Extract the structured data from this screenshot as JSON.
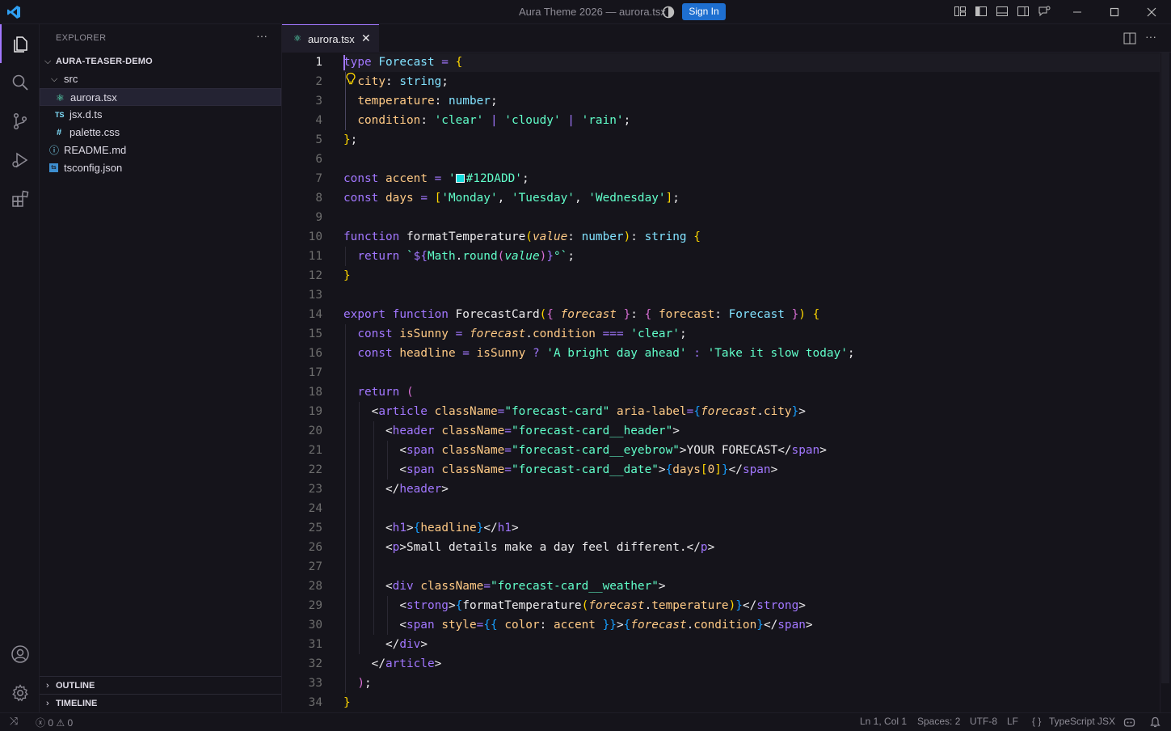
{
  "titlebar": {
    "title": "Aura Theme 2026 — aurora.tsx",
    "signin_label": "Sign In",
    "icons": [
      "vscode-logo-icon",
      "copilot-icon",
      "customize-layout-icon",
      "toggle-primary-sidebar-icon",
      "toggle-panel-icon",
      "toggle-secondary-sidebar-icon",
      "chat-icon",
      "minimize-icon",
      "maximize-icon",
      "close-icon"
    ]
  },
  "activitybar": {
    "items": [
      "explorer-icon",
      "search-icon",
      "source-control-icon",
      "run-debug-icon",
      "extensions-icon"
    ],
    "bottom": [
      "accounts-icon",
      "settings-gear-icon"
    ]
  },
  "sidebar": {
    "title": "EXPLORER",
    "more": "···",
    "root": "AURA-TEASER-DEMO",
    "tree": [
      {
        "label": "src",
        "type": "folder",
        "icon": ""
      },
      {
        "label": "aurora.tsx",
        "type": "file",
        "icon": "⚛",
        "selected": true
      },
      {
        "label": "jsx.d.ts",
        "type": "file",
        "icon": "TS"
      },
      {
        "label": "palette.css",
        "type": "file",
        "icon": "#"
      },
      {
        "label": "README.md",
        "type": "file",
        "icon": "ⓘ"
      },
      {
        "label": "tsconfig.json",
        "type": "file",
        "icon": "ts"
      }
    ],
    "panels": [
      "OUTLINE",
      "TIMELINE"
    ]
  },
  "tabs": [
    {
      "label": "aurora.tsx",
      "icon": "⚛",
      "close": "✕",
      "active": true
    }
  ],
  "editor": {
    "active_line": 1,
    "line_numbers": [
      "1",
      "2",
      "3",
      "4",
      "5",
      "6",
      "7",
      "8",
      "9",
      "10",
      "11",
      "12",
      "13",
      "14",
      "15",
      "16",
      "17",
      "18",
      "19",
      "20",
      "21",
      "22",
      "23",
      "24",
      "25",
      "26",
      "27",
      "28",
      "29",
      "30",
      "31",
      "32",
      "33",
      "34"
    ],
    "lines": [
      [
        {
          "t": "type",
          "c": "kw"
        },
        {
          "t": " ",
          "c": "pu"
        },
        {
          "t": "Forecast",
          "c": "ty"
        },
        {
          "t": " = ",
          "c": "op"
        },
        {
          "t": "{",
          "c": "b1"
        }
      ],
      [
        {
          "t": "  ",
          "c": "pu"
        },
        {
          "t": "city",
          "c": "pr"
        },
        {
          "t": ": ",
          "c": "pu"
        },
        {
          "t": "string",
          "c": "ty"
        },
        {
          "t": ";",
          "c": "pu"
        }
      ],
      [
        {
          "t": "  ",
          "c": "pu"
        },
        {
          "t": "temperature",
          "c": "pr"
        },
        {
          "t": ": ",
          "c": "pu"
        },
        {
          "t": "number",
          "c": "ty"
        },
        {
          "t": ";",
          "c": "pu"
        }
      ],
      [
        {
          "t": "  ",
          "c": "pu"
        },
        {
          "t": "condition",
          "c": "pr"
        },
        {
          "t": ": ",
          "c": "pu"
        },
        {
          "t": "'clear'",
          "c": "st"
        },
        {
          "t": " | ",
          "c": "op"
        },
        {
          "t": "'cloudy'",
          "c": "st"
        },
        {
          "t": " | ",
          "c": "op"
        },
        {
          "t": "'rain'",
          "c": "st"
        },
        {
          "t": ";",
          "c": "pu"
        }
      ],
      [
        {
          "t": "}",
          "c": "b1"
        },
        {
          "t": ";",
          "c": "pu"
        }
      ],
      [],
      [
        {
          "t": "const",
          "c": "kw"
        },
        {
          "t": " ",
          "c": "pu"
        },
        {
          "t": "accent",
          "c": "vr"
        },
        {
          "t": " = ",
          "c": "op"
        },
        {
          "t": "'",
          "c": "st"
        },
        {
          "t": "",
          "c": "swatch"
        },
        {
          "t": "#12DADD'",
          "c": "st"
        },
        {
          "t": ";",
          "c": "pu"
        }
      ],
      [
        {
          "t": "const",
          "c": "kw"
        },
        {
          "t": " ",
          "c": "pu"
        },
        {
          "t": "days",
          "c": "vr"
        },
        {
          "t": " = ",
          "c": "op"
        },
        {
          "t": "[",
          "c": "b1"
        },
        {
          "t": "'Monday'",
          "c": "st"
        },
        {
          "t": ", ",
          "c": "pu"
        },
        {
          "t": "'Tuesday'",
          "c": "st"
        },
        {
          "t": ", ",
          "c": "pu"
        },
        {
          "t": "'Wednesday'",
          "c": "st"
        },
        {
          "t": "]",
          "c": "b1"
        },
        {
          "t": ";",
          "c": "pu"
        }
      ],
      [],
      [
        {
          "t": "function",
          "c": "kw"
        },
        {
          "t": " ",
          "c": "pu"
        },
        {
          "t": "formatTemperature",
          "c": "fn"
        },
        {
          "t": "(",
          "c": "b1"
        },
        {
          "t": "value",
          "c": "vr it"
        },
        {
          "t": ": ",
          "c": "pu"
        },
        {
          "t": "number",
          "c": "ty"
        },
        {
          "t": ")",
          "c": "b1"
        },
        {
          "t": ": ",
          "c": "pu"
        },
        {
          "t": "string",
          "c": "ty"
        },
        {
          "t": " ",
          "c": "pu"
        },
        {
          "t": "{",
          "c": "b1"
        }
      ],
      [
        {
          "t": "  ",
          "c": "pu"
        },
        {
          "t": "return",
          "c": "kw"
        },
        {
          "t": " ",
          "c": "pu"
        },
        {
          "t": "`",
          "c": "st"
        },
        {
          "t": "${",
          "c": "kw"
        },
        {
          "t": "Math",
          "c": "st"
        },
        {
          "t": ".",
          "c": "pu"
        },
        {
          "t": "round",
          "c": "st"
        },
        {
          "t": "(",
          "c": "b2"
        },
        {
          "t": "value",
          "c": "st it"
        },
        {
          "t": ")",
          "c": "b2"
        },
        {
          "t": "}",
          "c": "kw"
        },
        {
          "t": "°`",
          "c": "st"
        },
        {
          "t": ";",
          "c": "pu"
        }
      ],
      [
        {
          "t": "}",
          "c": "b1"
        }
      ],
      [],
      [
        {
          "t": "export",
          "c": "kw"
        },
        {
          "t": " ",
          "c": "pu"
        },
        {
          "t": "function",
          "c": "kw"
        },
        {
          "t": " ",
          "c": "pu"
        },
        {
          "t": "ForecastCard",
          "c": "fn"
        },
        {
          "t": "(",
          "c": "b1"
        },
        {
          "t": "{",
          "c": "b2"
        },
        {
          "t": " ",
          "c": "pu"
        },
        {
          "t": "forecast",
          "c": "vr it"
        },
        {
          "t": " ",
          "c": "pu"
        },
        {
          "t": "}",
          "c": "b2"
        },
        {
          "t": ": ",
          "c": "pu"
        },
        {
          "t": "{",
          "c": "b2"
        },
        {
          "t": " ",
          "c": "pu"
        },
        {
          "t": "forecast",
          "c": "pr"
        },
        {
          "t": ": ",
          "c": "pu"
        },
        {
          "t": "Forecast",
          "c": "ty"
        },
        {
          "t": " ",
          "c": "pu"
        },
        {
          "t": "}",
          "c": "b2"
        },
        {
          "t": ")",
          "c": "b1"
        },
        {
          "t": " ",
          "c": "pu"
        },
        {
          "t": "{",
          "c": "b1"
        }
      ],
      [
        {
          "t": "  ",
          "c": "pu"
        },
        {
          "t": "const",
          "c": "kw"
        },
        {
          "t": " ",
          "c": "pu"
        },
        {
          "t": "isSunny",
          "c": "vr"
        },
        {
          "t": " = ",
          "c": "op"
        },
        {
          "t": "forecast",
          "c": "vr it"
        },
        {
          "t": ".",
          "c": "pu"
        },
        {
          "t": "condition",
          "c": "pr"
        },
        {
          "t": " === ",
          "c": "op"
        },
        {
          "t": "'clear'",
          "c": "st"
        },
        {
          "t": ";",
          "c": "pu"
        }
      ],
      [
        {
          "t": "  ",
          "c": "pu"
        },
        {
          "t": "const",
          "c": "kw"
        },
        {
          "t": " ",
          "c": "pu"
        },
        {
          "t": "headline",
          "c": "vr"
        },
        {
          "t": " = ",
          "c": "op"
        },
        {
          "t": "isSunny",
          "c": "vr"
        },
        {
          "t": " ? ",
          "c": "op"
        },
        {
          "t": "'A bright day ahead'",
          "c": "st"
        },
        {
          "t": " : ",
          "c": "op"
        },
        {
          "t": "'Take it slow today'",
          "c": "st"
        },
        {
          "t": ";",
          "c": "pu"
        }
      ],
      [],
      [
        {
          "t": "  ",
          "c": "pu"
        },
        {
          "t": "return",
          "c": "kw"
        },
        {
          "t": " ",
          "c": "pu"
        },
        {
          "t": "(",
          "c": "b2"
        }
      ],
      [
        {
          "t": "    ",
          "c": "pu"
        },
        {
          "t": "<",
          "c": "pu"
        },
        {
          "t": "article",
          "c": "tg"
        },
        {
          "t": " ",
          "c": "pu"
        },
        {
          "t": "className",
          "c": "at"
        },
        {
          "t": "=",
          "c": "op"
        },
        {
          "t": "\"forecast-card\"",
          "c": "st"
        },
        {
          "t": " ",
          "c": "pu"
        },
        {
          "t": "aria-label",
          "c": "at"
        },
        {
          "t": "=",
          "c": "op"
        },
        {
          "t": "{",
          "c": "b3"
        },
        {
          "t": "forecast",
          "c": "vr it"
        },
        {
          "t": ".",
          "c": "pu"
        },
        {
          "t": "city",
          "c": "pr"
        },
        {
          "t": "}",
          "c": "b3"
        },
        {
          "t": ">",
          "c": "pu"
        }
      ],
      [
        {
          "t": "      ",
          "c": "pu"
        },
        {
          "t": "<",
          "c": "pu"
        },
        {
          "t": "header",
          "c": "tg"
        },
        {
          "t": " ",
          "c": "pu"
        },
        {
          "t": "className",
          "c": "at"
        },
        {
          "t": "=",
          "c": "op"
        },
        {
          "t": "\"forecast-card__header\"",
          "c": "st"
        },
        {
          "t": ">",
          "c": "pu"
        }
      ],
      [
        {
          "t": "        ",
          "c": "pu"
        },
        {
          "t": "<",
          "c": "pu"
        },
        {
          "t": "span",
          "c": "tg"
        },
        {
          "t": " ",
          "c": "pu"
        },
        {
          "t": "className",
          "c": "at"
        },
        {
          "t": "=",
          "c": "op"
        },
        {
          "t": "\"forecast-card__eyebrow\"",
          "c": "st"
        },
        {
          "t": ">YOUR FORECAST</",
          "c": "pu"
        },
        {
          "t": "span",
          "c": "tg"
        },
        {
          "t": ">",
          "c": "pu"
        }
      ],
      [
        {
          "t": "        ",
          "c": "pu"
        },
        {
          "t": "<",
          "c": "pu"
        },
        {
          "t": "span",
          "c": "tg"
        },
        {
          "t": " ",
          "c": "pu"
        },
        {
          "t": "className",
          "c": "at"
        },
        {
          "t": "=",
          "c": "op"
        },
        {
          "t": "\"forecast-card__date\"",
          "c": "st"
        },
        {
          "t": ">",
          "c": "pu"
        },
        {
          "t": "{",
          "c": "b3"
        },
        {
          "t": "days",
          "c": "vr"
        },
        {
          "t": "[",
          "c": "b1"
        },
        {
          "t": "0",
          "c": "vr"
        },
        {
          "t": "]",
          "c": "b1"
        },
        {
          "t": "}",
          "c": "b3"
        },
        {
          "t": "</",
          "c": "pu"
        },
        {
          "t": "span",
          "c": "tg"
        },
        {
          "t": ">",
          "c": "pu"
        }
      ],
      [
        {
          "t": "      ",
          "c": "pu"
        },
        {
          "t": "</",
          "c": "pu"
        },
        {
          "t": "header",
          "c": "tg"
        },
        {
          "t": ">",
          "c": "pu"
        }
      ],
      [],
      [
        {
          "t": "      ",
          "c": "pu"
        },
        {
          "t": "<",
          "c": "pu"
        },
        {
          "t": "h1",
          "c": "tg"
        },
        {
          "t": ">",
          "c": "pu"
        },
        {
          "t": "{",
          "c": "b3"
        },
        {
          "t": "headline",
          "c": "vr"
        },
        {
          "t": "}",
          "c": "b3"
        },
        {
          "t": "</",
          "c": "pu"
        },
        {
          "t": "h1",
          "c": "tg"
        },
        {
          "t": ">",
          "c": "pu"
        }
      ],
      [
        {
          "t": "      ",
          "c": "pu"
        },
        {
          "t": "<",
          "c": "pu"
        },
        {
          "t": "p",
          "c": "tg"
        },
        {
          "t": ">Small details make a day feel different.</",
          "c": "pu"
        },
        {
          "t": "p",
          "c": "tg"
        },
        {
          "t": ">",
          "c": "pu"
        }
      ],
      [],
      [
        {
          "t": "      ",
          "c": "pu"
        },
        {
          "t": "<",
          "c": "pu"
        },
        {
          "t": "div",
          "c": "tg"
        },
        {
          "t": " ",
          "c": "pu"
        },
        {
          "t": "className",
          "c": "at"
        },
        {
          "t": "=",
          "c": "op"
        },
        {
          "t": "\"forecast-card__weather\"",
          "c": "st"
        },
        {
          "t": ">",
          "c": "pu"
        }
      ],
      [
        {
          "t": "        ",
          "c": "pu"
        },
        {
          "t": "<",
          "c": "pu"
        },
        {
          "t": "strong",
          "c": "tg"
        },
        {
          "t": ">",
          "c": "pu"
        },
        {
          "t": "{",
          "c": "b3"
        },
        {
          "t": "formatTemperature",
          "c": "fn"
        },
        {
          "t": "(",
          "c": "b1"
        },
        {
          "t": "forecast",
          "c": "vr it"
        },
        {
          "t": ".",
          "c": "pu"
        },
        {
          "t": "temperature",
          "c": "pr"
        },
        {
          "t": ")",
          "c": "b1"
        },
        {
          "t": "}",
          "c": "b3"
        },
        {
          "t": "</",
          "c": "pu"
        },
        {
          "t": "strong",
          "c": "tg"
        },
        {
          "t": ">",
          "c": "pu"
        }
      ],
      [
        {
          "t": "        ",
          "c": "pu"
        },
        {
          "t": "<",
          "c": "pu"
        },
        {
          "t": "span",
          "c": "tg"
        },
        {
          "t": " ",
          "c": "pu"
        },
        {
          "t": "style",
          "c": "at"
        },
        {
          "t": "=",
          "c": "op"
        },
        {
          "t": "{{",
          "c": "b3"
        },
        {
          "t": " ",
          "c": "pu"
        },
        {
          "t": "color",
          "c": "pr"
        },
        {
          "t": ": ",
          "c": "pu"
        },
        {
          "t": "accent",
          "c": "vr"
        },
        {
          "t": " ",
          "c": "pu"
        },
        {
          "t": "}}",
          "c": "b3"
        },
        {
          "t": ">",
          "c": "pu"
        },
        {
          "t": "{",
          "c": "b3"
        },
        {
          "t": "forecast",
          "c": "vr it"
        },
        {
          "t": ".",
          "c": "pu"
        },
        {
          "t": "condition",
          "c": "pr"
        },
        {
          "t": "}",
          "c": "b3"
        },
        {
          "t": "</",
          "c": "pu"
        },
        {
          "t": "span",
          "c": "tg"
        },
        {
          "t": ">",
          "c": "pu"
        }
      ],
      [
        {
          "t": "      ",
          "c": "pu"
        },
        {
          "t": "</",
          "c": "pu"
        },
        {
          "t": "div",
          "c": "tg"
        },
        {
          "t": ">",
          "c": "pu"
        }
      ],
      [
        {
          "t": "    ",
          "c": "pu"
        },
        {
          "t": "</",
          "c": "pu"
        },
        {
          "t": "article",
          "c": "tg"
        },
        {
          "t": ">",
          "c": "pu"
        }
      ],
      [
        {
          "t": "  ",
          "c": "pu"
        },
        {
          "t": ")",
          "c": "b2"
        },
        {
          "t": ";",
          "c": "pu"
        }
      ],
      [
        {
          "t": "}",
          "c": "b1"
        }
      ]
    ]
  },
  "statusbar": {
    "remote": "⤨",
    "errors": "0",
    "warnings": "0",
    "position": "Ln 1, Col 1",
    "spaces": "Spaces: 2",
    "encoding": "UTF-8",
    "eol": "LF",
    "language_braces": "{ }",
    "language": "TypeScript JSX"
  },
  "colors": {
    "background": "#15141b",
    "accent": "#a277ff",
    "signin": "#1e6fd0",
    "string": "#61ffca",
    "type": "#82e2ff",
    "variable": "#ffca85",
    "swatch": "#12DADD"
  }
}
